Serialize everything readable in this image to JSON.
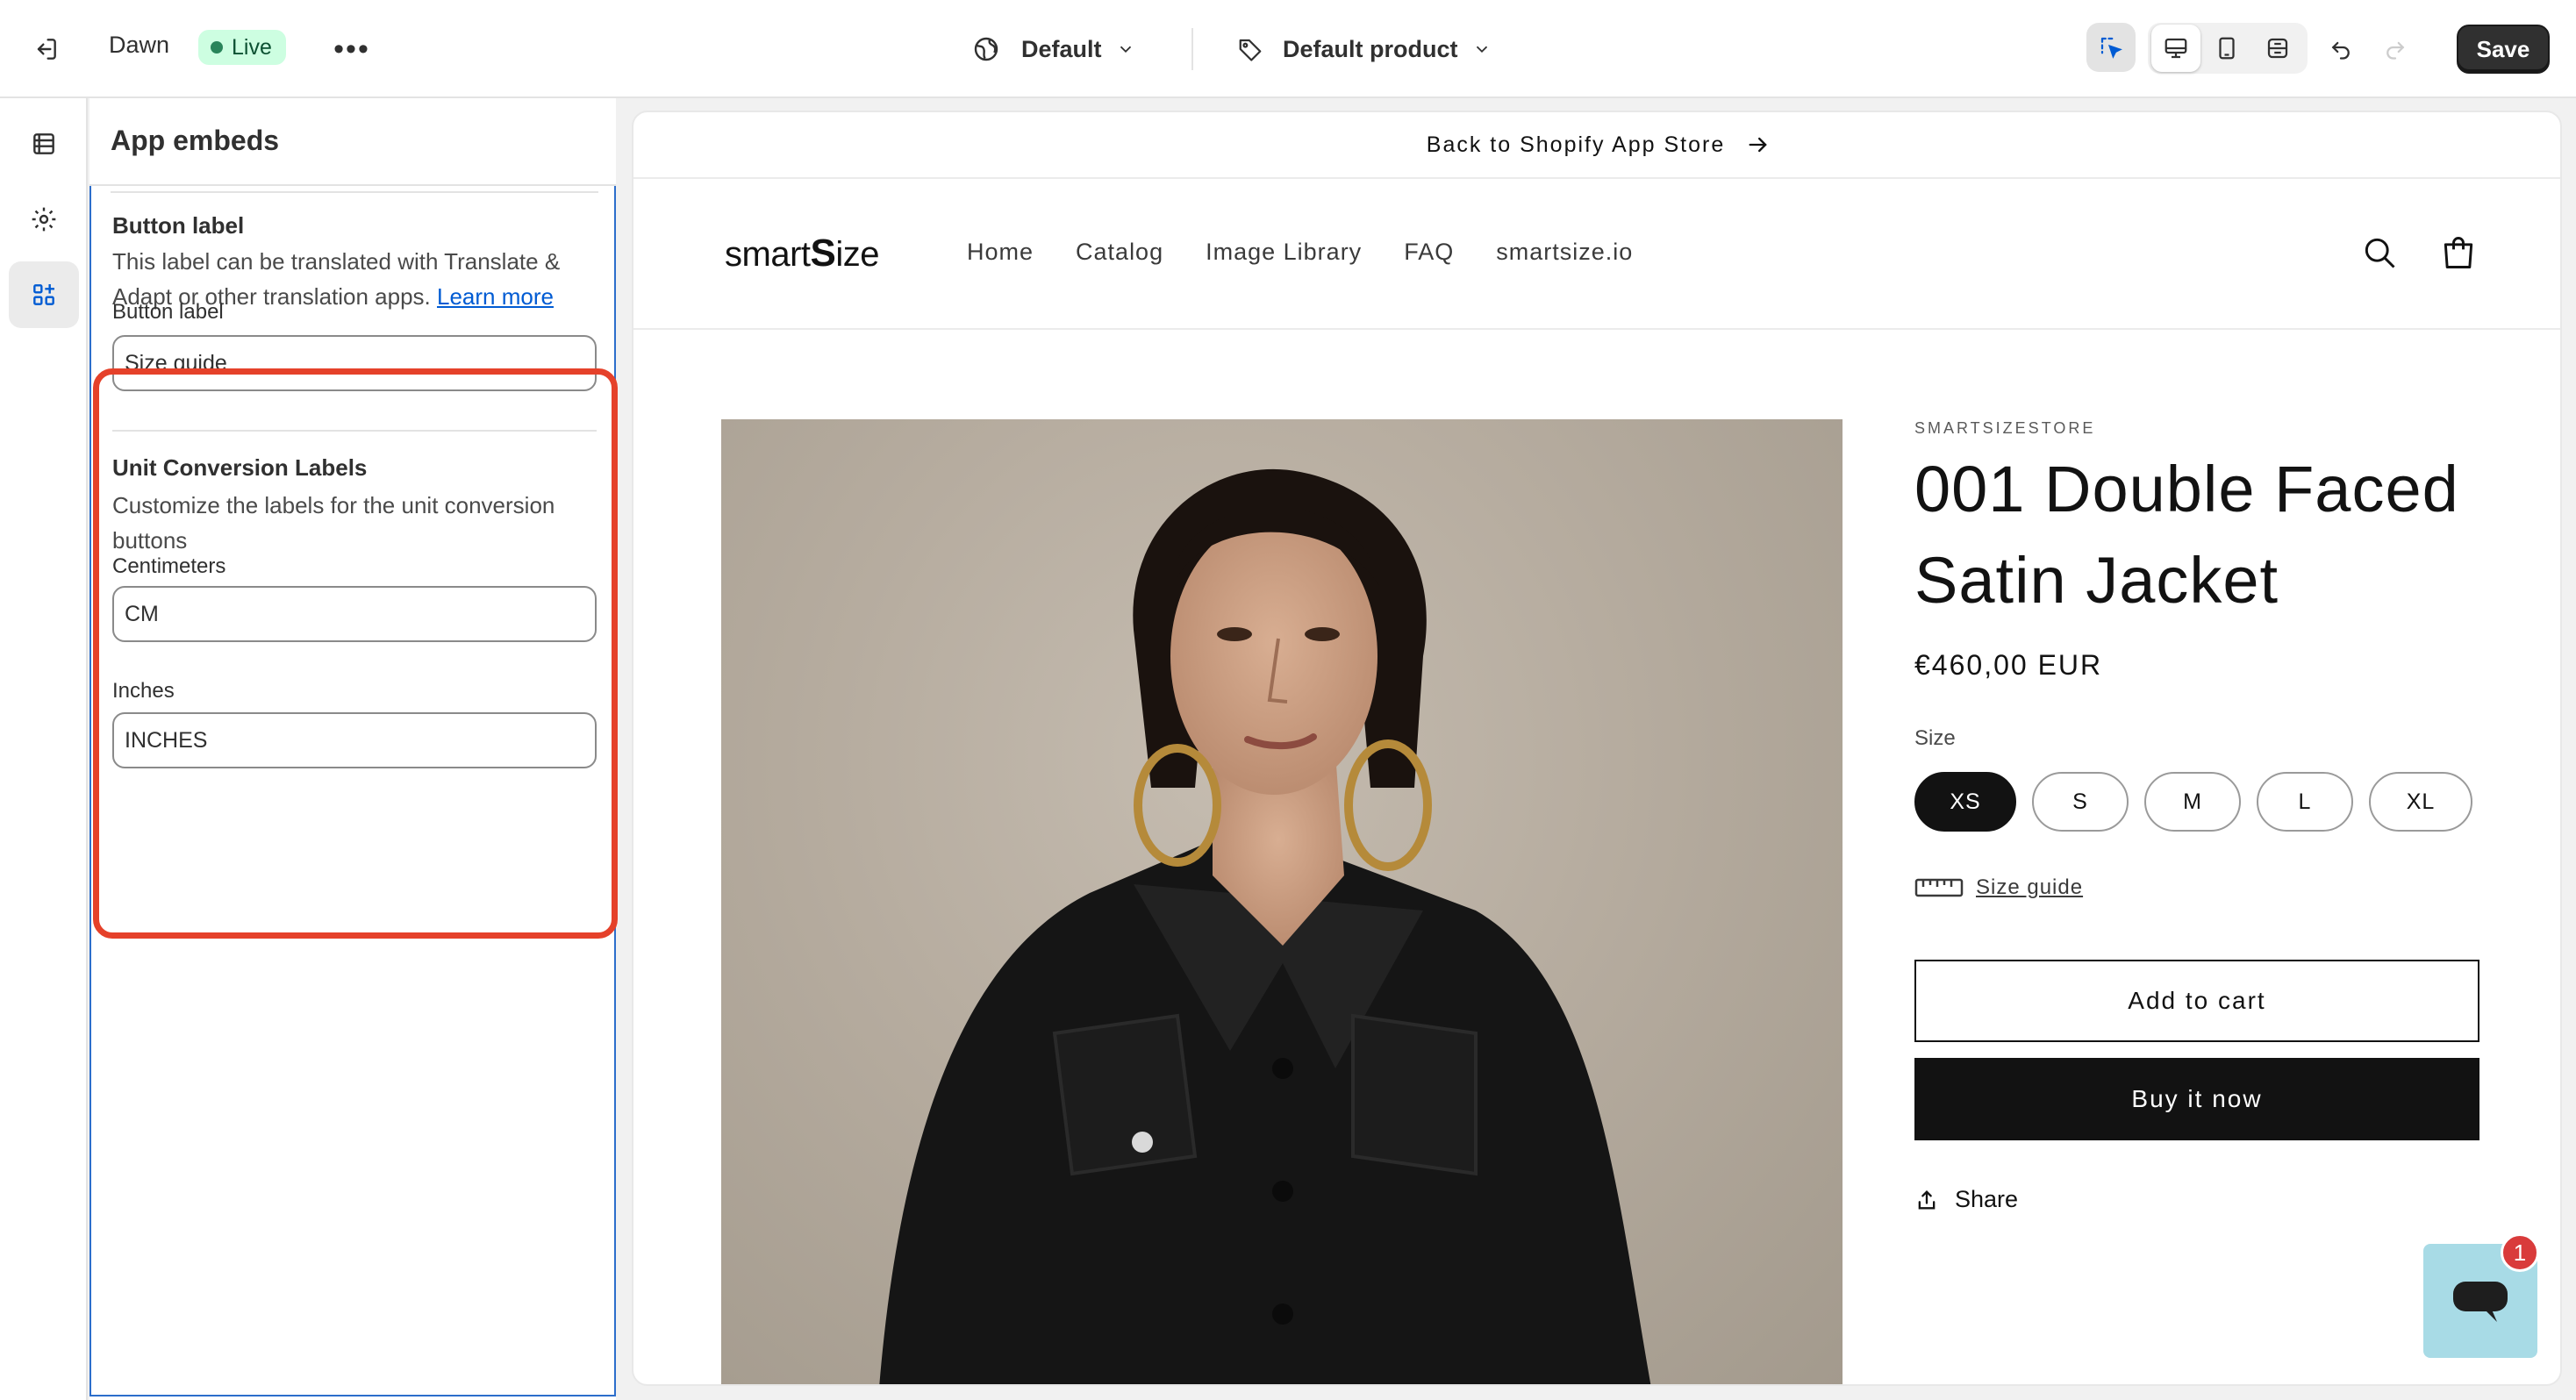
{
  "topbar": {
    "theme_name": "Dawn",
    "status_badge": "Live",
    "more": "•••",
    "market_select": "Default",
    "template_select": "Default product",
    "save_label": "Save"
  },
  "sidebar": {
    "title": "App embeds",
    "button_label_section": {
      "title": "Button label",
      "help_text": "This label can be translated with Translate & Adapt or other translation apps.",
      "help_link": "Learn more",
      "field_label": "Button label",
      "field_value": "Size guide"
    },
    "unit_section": {
      "title": "Unit Conversion Labels",
      "help_text": "Customize the labels for the unit conversion buttons",
      "cm_label": "Centimeters",
      "cm_value": "CM",
      "inches_label": "Inches",
      "inches_value": "INCHES"
    }
  },
  "preview": {
    "announcement": "Back to Shopify App Store",
    "logo_prefix": "smart",
    "logo_mark": "S",
    "logo_suffix": "ize",
    "nav": [
      "Home",
      "Catalog",
      "Image Library",
      "FAQ",
      "smartsize.io"
    ],
    "product": {
      "vendor": "SMARTSIZESTORE",
      "title": "001 Double Faced Satin Jacket",
      "price": "€460,00 EUR",
      "size_label": "Size",
      "sizes": [
        "XS",
        "S",
        "M",
        "L",
        "XL"
      ],
      "selected_size": "XS",
      "size_guide": "Size guide",
      "add_to_cart": "Add to cart",
      "buy_now": "Buy it now",
      "share": "Share"
    },
    "chat_badge_count": "1"
  },
  "colors": {
    "accent_link": "#005bd3",
    "highlight": "#e5412a",
    "live_bg": "#cdfee1",
    "live_dot": "#29845a",
    "chat_bg": "#a8dbe6",
    "badge_red": "#d93b3b"
  },
  "icons": [
    "exit-icon",
    "globe-icon",
    "tag-icon",
    "chevron-down-icon",
    "inspector-icon",
    "desktop-icon",
    "mobile-icon",
    "fullscreen-icon",
    "undo-icon",
    "redo-icon",
    "sections-icon",
    "settings-icon",
    "apps-icon",
    "arrow-right-icon",
    "search-icon",
    "cart-icon",
    "ruler-icon",
    "share-icon",
    "chat-icon"
  ]
}
